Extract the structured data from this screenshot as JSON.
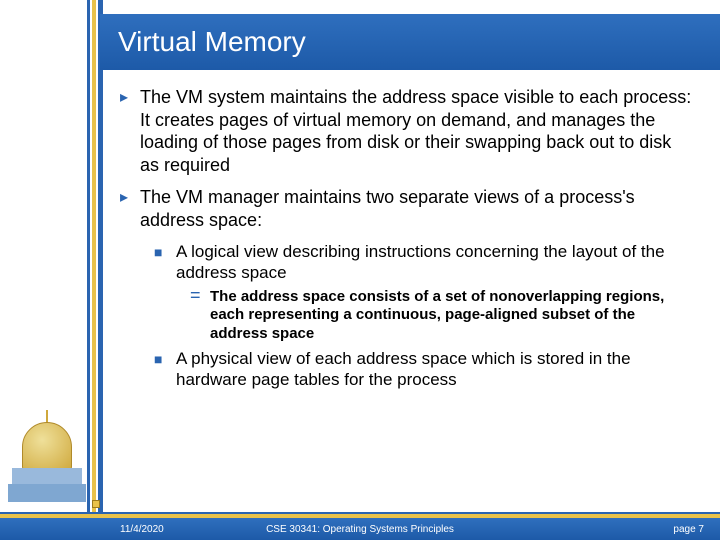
{
  "title": "Virtual Memory",
  "bullets": {
    "b1a": "The VM system maintains the address space visible to each process:  It creates pages of virtual memory on demand, and manages the loading of those pages from disk or their swapping back out to disk as required",
    "b1b": "The VM manager maintains two separate views of a process's address space:",
    "b2a": "A logical view describing instructions concerning the layout of the address space",
    "b3a": "The address space consists of a set of nonoverlapping regions, each representing a continuous, page-aligned subset of the address space",
    "b2b": "A physical view of each address space which is stored in the hardware page tables for the process"
  },
  "footer": {
    "date": "11/4/2020",
    "course": "CSE 30341: Operating Systems Principles",
    "page": "page 7"
  },
  "markers": {
    "l1": "▸",
    "l2": "■",
    "l3": "="
  }
}
